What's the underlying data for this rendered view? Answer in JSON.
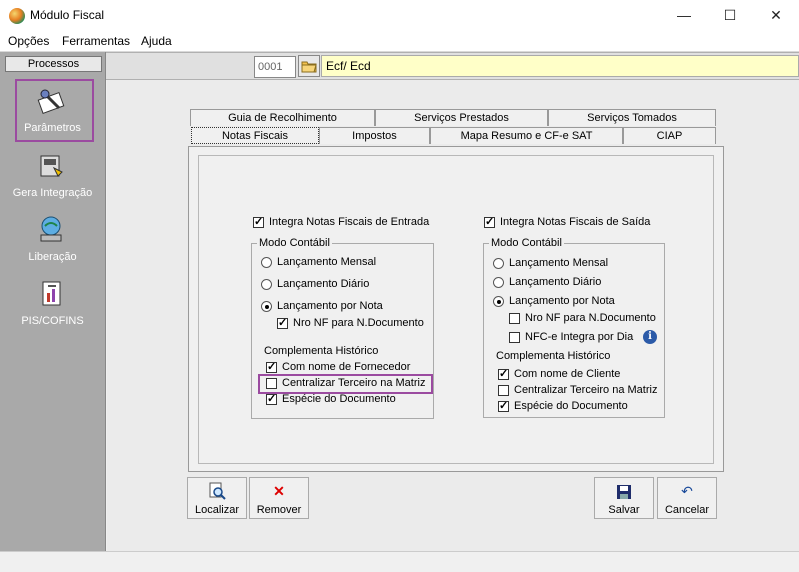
{
  "window": {
    "title": "Módulo Fiscal",
    "minimize": "—",
    "maximize": "☐",
    "close": "✕"
  },
  "menu": [
    "Opções",
    "Ferramentas",
    "Ajuda"
  ],
  "sidebar": {
    "header": "Processos",
    "items": [
      {
        "label": "Parâmetros",
        "icon": "parameters-icon"
      },
      {
        "label": "Gera Integração",
        "icon": "integration-icon"
      },
      {
        "label": "Liberação",
        "icon": "release-icon"
      },
      {
        "label": "PIS/COFINS",
        "icon": "pis-cofins-icon"
      }
    ]
  },
  "toolbar": {
    "code": "0001",
    "description": "Ecf/ Ecd"
  },
  "tabs_row1": [
    "Guia de Recolhimento",
    "Serviços Prestados",
    "Serviços Tomados"
  ],
  "tabs_row2": [
    "Notas Fiscais",
    "Impostos",
    "Mapa Resumo e CF-e SAT",
    "CIAP"
  ],
  "entrada": {
    "integra_label": "Integra Notas Fiscais de Entrada",
    "modo_label": "Modo Contábil",
    "radios": [
      "Lançamento Mensal",
      "Lançamento Diário",
      "Lançamento por Nota"
    ],
    "nro_nf": "Nro NF para N.Documento",
    "comp_label": "Complementa Histórico",
    "comp": [
      "Com nome de Fornecedor",
      "Centralizar Terceiro na Matriz",
      "Espécie do Documento"
    ]
  },
  "saida": {
    "integra_label": "Integra Notas Fiscais de Saída",
    "modo_label": "Modo Contábil",
    "radios": [
      "Lançamento Mensal",
      "Lançamento Diário",
      "Lançamento por Nota"
    ],
    "nro_nf": "Nro NF para N.Documento",
    "nfce": "NFC-e Integra por Dia",
    "comp_label": "Complementa Histórico",
    "comp": [
      "Com nome de Cliente",
      "Centralizar Terceiro na Matriz",
      "Espécie do Documento"
    ]
  },
  "buttons": {
    "localizar": "Localizar",
    "remover": "Remover",
    "salvar": "Salvar",
    "cancelar": "Cancelar"
  }
}
